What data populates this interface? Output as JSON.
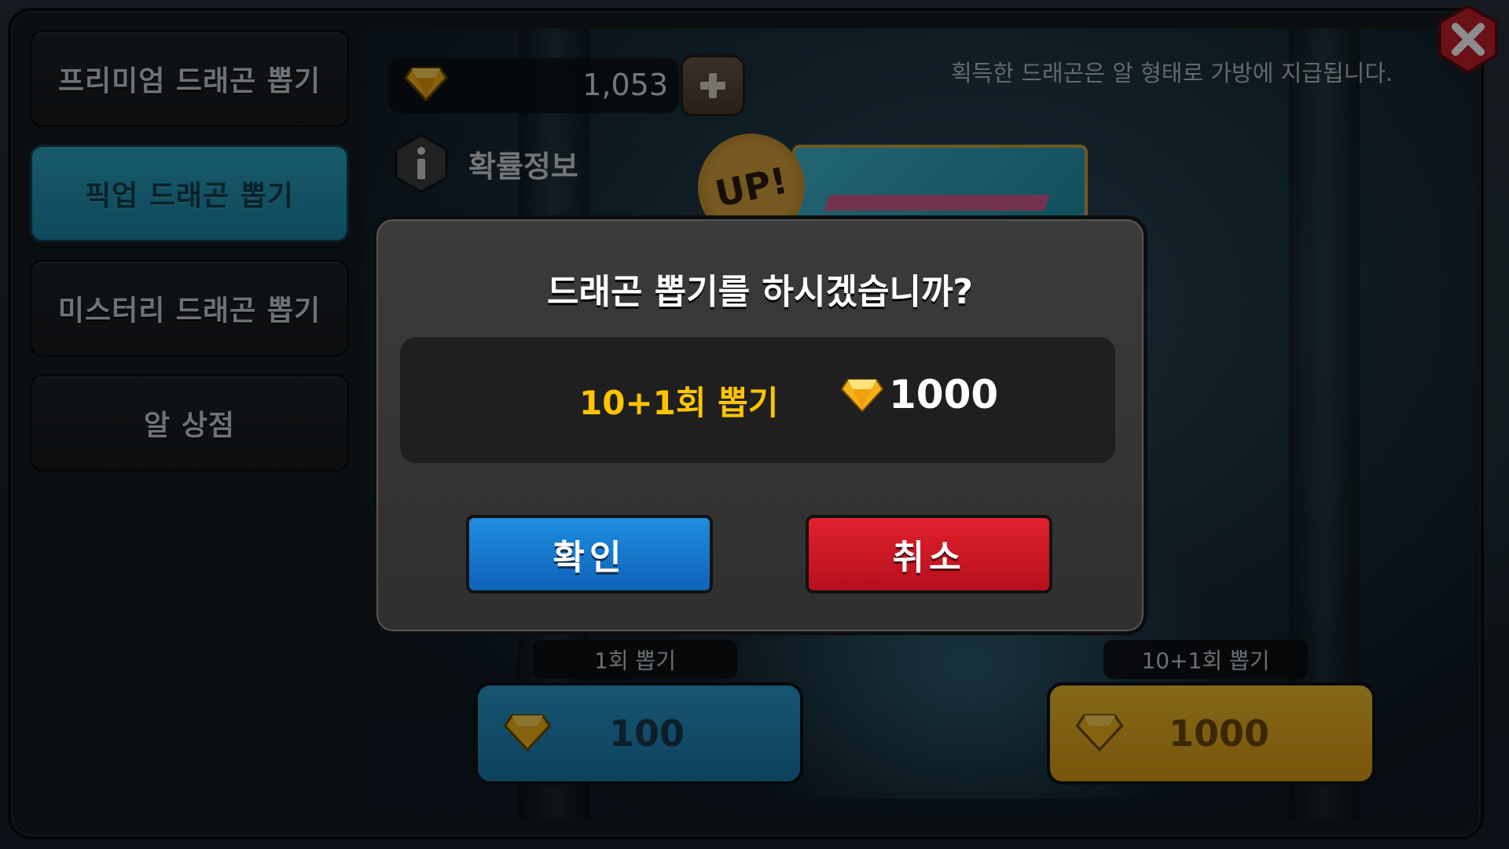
{
  "tabs": [
    {
      "label": "프리미엄 드래곤 뽑기",
      "active": false
    },
    {
      "label": "픽업 드래곤 뽑기",
      "active": true
    },
    {
      "label": "미스터리 드래곤 뽑기",
      "active": false
    },
    {
      "label": "알 상점",
      "active": false
    }
  ],
  "currency": {
    "amount": "1,053",
    "icon": "diamond-icon"
  },
  "notice": "획득한 드래곤은 알 형태로 가방에 지급됩니다.",
  "info": {
    "label": "확률정보"
  },
  "banner": {
    "badge": "UP!"
  },
  "pulls": [
    {
      "label": "1회 뽑기",
      "price": "100",
      "color": "#1f86bb"
    },
    {
      "label": "10+1회 뽑기",
      "price": "1000",
      "color": "#e6aa1f"
    }
  ],
  "modal": {
    "title": "드래곤 뽑기를 하시겠습니까?",
    "option_label": "10+1회 뽑기",
    "price": "1000",
    "confirm_label": "확인",
    "cancel_label": "취소"
  },
  "colors": {
    "active_tab": "#1f94b5",
    "confirm": "#1a7fd6",
    "cancel": "#d0131f",
    "highlight_text": "#ffc400"
  }
}
